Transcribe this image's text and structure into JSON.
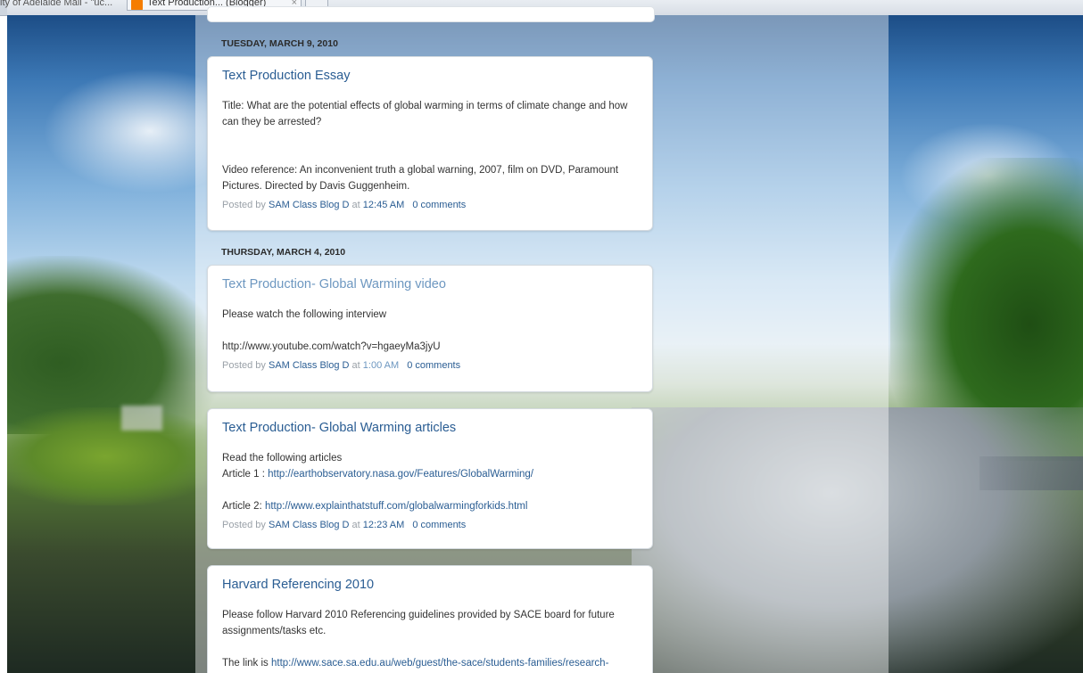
{
  "browser": {
    "tab1_label": "ity of Adelaide Mail - \"uc...",
    "tab2_label": "Text Production... (Blogger)",
    "tab_close": "×"
  },
  "posts": [
    {
      "date": "TUESDAY, MARCH 9, 2010",
      "title": "Text Production Essay",
      "paragraphs": [
        "Title: What are the potential effects of global warming in terms of climate change and how can they be arrested?",
        "Video reference: An inconvenient truth a global warning, 2007, film on DVD, Paramount Pictures. Directed by Davis Guggenheim."
      ],
      "posted_by_prefix": "Posted by",
      "author": "SAM Class Blog D",
      "at": "at",
      "time": "12:45 AM",
      "comments": "0 comments"
    },
    {
      "date": "THURSDAY, MARCH 4, 2010",
      "title": "Text Production- Global Warming video",
      "paragraphs": [
        "Please watch the following interview",
        "http://www.youtube.com/watch?v=hgaeyMa3jyU"
      ],
      "posted_by_prefix": "Posted by",
      "author": "SAM Class Blog D",
      "at": "at",
      "time": "1:00 AM",
      "comments": "0 comments"
    },
    {
      "title": "Text Production- Global Warming articles",
      "intro": "Read the following articles",
      "article1_label": "Article 1 :",
      "article1_link": "http://earthobservatory.nasa.gov/Features/GlobalWarming/",
      "article2_label": "Article 2:",
      "article2_link": "http://www.explainthatstuff.com/globalwarmingforkids.html",
      "posted_by_prefix": "Posted by",
      "author": "SAM Class Blog D",
      "at": "at",
      "time": "12:23 AM",
      "comments": "0 comments"
    },
    {
      "title": "Harvard Referencing 2010",
      "paragraph": "Please follow Harvard 2010 Referencing guidelines provided by SACE board for future assignments/tasks etc.",
      "link_prefix": "The link is",
      "link": "http://www.sace.sa.edu.au/web/guest/the-sace/students-families/research-"
    }
  ]
}
